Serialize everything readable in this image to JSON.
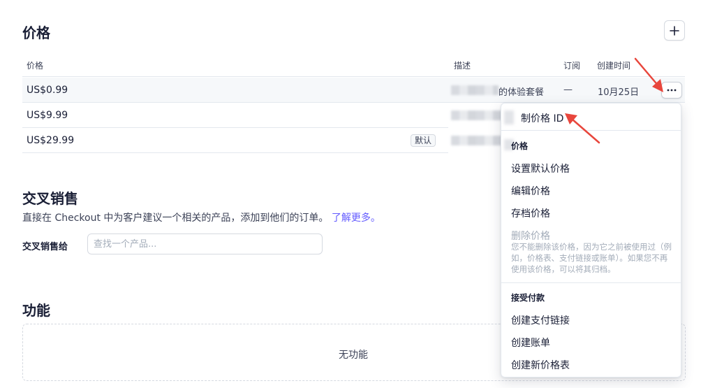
{
  "prices_section": {
    "title": "价格",
    "columns": {
      "price": "价格",
      "description": "描述",
      "subscription": "订阅",
      "created": "创建时间"
    },
    "rows": [
      {
        "price": "US$0.99",
        "description": "的体验套餐",
        "subscription": "—",
        "created": "10月25日"
      },
      {
        "price": "US$9.99",
        "badge": ""
      },
      {
        "price": "US$29.99",
        "badge": "默认"
      }
    ]
  },
  "cross_sell": {
    "title": "交叉销售",
    "description": "直接在 Checkout 中为客户建议一个相关的产品，添加到他们的订单。",
    "learn_more": "了解更多。",
    "field_label": "交叉销售给",
    "search_placeholder": "查找一个产品..."
  },
  "features": {
    "title": "功能",
    "empty_text": "无功能"
  },
  "dropdown": {
    "copy_id": "制价格 ID",
    "price_header": "价格",
    "set_default": "设置默认价格",
    "edit": "编辑价格",
    "archive": "存档价格",
    "delete": "删除价格",
    "delete_note": "您不能删除该价格，因为它之前被使用过（例如，价格表、支付链接或账单）。如果您不再使用该价格，可以将其归档。",
    "accept_payments_header": "接受付款",
    "create_payment_link": "创建支付链接",
    "create_invoice": "创建账单",
    "create_pricing_table": "创建新价格表"
  },
  "colors": {
    "accent": "#635bff",
    "annotation_arrow": "#e8463c"
  }
}
